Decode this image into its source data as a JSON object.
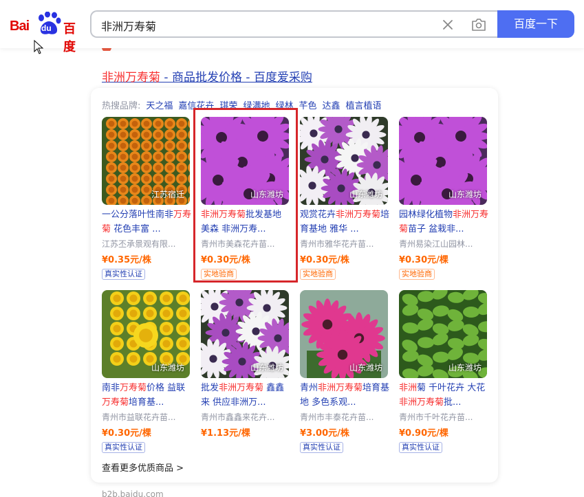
{
  "header": {
    "logo_bai": "Bai",
    "logo_du": "du",
    "logo_cn": "百度",
    "search_value": "非洲万寿菊",
    "search_button": "百度一下"
  },
  "result": {
    "title_hl": "非洲万寿菊",
    "title_rest": " - 商品批发价格 - 百度爱采购"
  },
  "brands": {
    "label": "热搜品牌:",
    "items": [
      "天之福",
      "嘉信花卉",
      "琪荣",
      "绿满地",
      "绿林",
      "芊色",
      "达鑫",
      "植言植语"
    ]
  },
  "products": [
    {
      "title_parts": [
        {
          "t": "一公分落叶性南非"
        },
        {
          "t": "万寿菊",
          "hl": true
        },
        {
          "t": " 花色丰富 ..."
        }
      ],
      "shop": "江苏丕承景观有限...",
      "price": "¥0.35元/株",
      "tag": "真实性认证",
      "tag_type": "verify",
      "location": "江苏宿迁",
      "image": "marigold-orange"
    },
    {
      "title_parts": [
        {
          "t": "非洲万寿菊",
          "hl": true
        },
        {
          "t": "批发基地 美森 非洲万寿..."
        }
      ],
      "shop": "青州市美森花卉苗...",
      "price": "¥0.30元/株",
      "tag": "实地验商",
      "tag_type": "onsite",
      "location": "山东潍坊",
      "image": "daisy-purple"
    },
    {
      "title_parts": [
        {
          "t": "观赏花卉"
        },
        {
          "t": "非洲万寿菊",
          "hl": true
        },
        {
          "t": "培育基地 雅华 ..."
        }
      ],
      "shop": "青州市雅华花卉苗...",
      "price": "¥0.30元/株",
      "tag": "实地验商",
      "tag_type": "onsite",
      "location": "山东潍坊",
      "image": "daisy-mixed"
    },
    {
      "title_parts": [
        {
          "t": "园林绿化植物"
        },
        {
          "t": "非洲万寿菊",
          "hl": true
        },
        {
          "t": "苗子 盆栽非..."
        }
      ],
      "shop": "青州易染江山园林...",
      "price": "¥0.30元/棵",
      "tag": "实地验商",
      "tag_type": "onsite",
      "location": "山东潍坊",
      "image": "daisy-purple"
    },
    {
      "title_parts": [
        {
          "t": "南非"
        },
        {
          "t": "万寿菊",
          "hl": true
        },
        {
          "t": "价格 益联 "
        },
        {
          "t": "万寿菊",
          "hl": true
        },
        {
          "t": "培育基..."
        }
      ],
      "shop": "青州市益联花卉苗...",
      "price": "¥0.30元/棵",
      "tag": "真实性认证",
      "tag_type": "verify",
      "location": "山东潍坊",
      "image": "marigold-yellow"
    },
    {
      "title_parts": [
        {
          "t": "批发"
        },
        {
          "t": "非洲万寿菊",
          "hl": true
        },
        {
          "t": " 鑫鑫来 供应非洲万..."
        }
      ],
      "shop": "青州市鑫鑫来花卉...",
      "price": "¥1.13元/棵",
      "tag": "",
      "tag_type": "",
      "location": "山东潍坊",
      "image": "daisy-mixed"
    },
    {
      "title_parts": [
        {
          "t": "青州"
        },
        {
          "t": "非洲万寿菊",
          "hl": true
        },
        {
          "t": "培育基地 多色系观..."
        }
      ],
      "shop": "青州市丰泰花卉苗...",
      "price": "¥3.00元/株",
      "tag": "真实性认证",
      "tag_type": "verify",
      "location": "山东潍坊",
      "image": "daisy-pink"
    },
    {
      "title_parts": [
        {
          "t": "非洲",
          "hl": true
        },
        {
          "t": "菊 千叶花卉 大花"
        },
        {
          "t": "非洲万寿菊",
          "hl": true
        },
        {
          "t": "批..."
        }
      ],
      "shop": "青州市千叶花卉苗...",
      "price": "¥0.90元/棵",
      "tag": "真实性认证",
      "tag_type": "verify",
      "location": "山东潍坊",
      "image": "seedling-green"
    }
  ],
  "more_link": "查看更多优质商品 >",
  "source": "b2b.baidu.com"
}
